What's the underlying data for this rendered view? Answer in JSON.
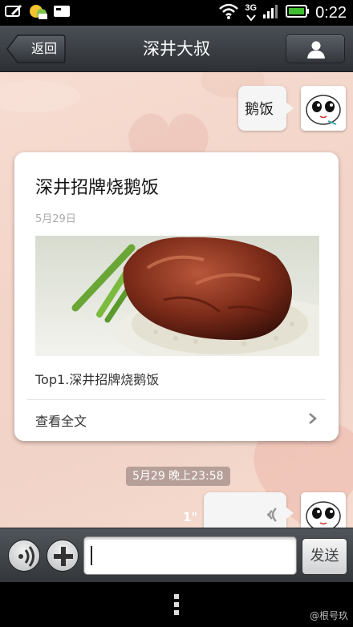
{
  "status_bar": {
    "time": "0:22",
    "network": "3G",
    "icons": [
      "edit-note-icon",
      "chat-app-icon",
      "message-icon",
      "wifi-icon",
      "sync-icon",
      "signal-icon",
      "battery-icon"
    ]
  },
  "header": {
    "back_label": "返回",
    "title": "深井大叔",
    "profile_icon": "person-icon"
  },
  "messages": {
    "outgoing_text": "鹅饭",
    "article": {
      "title": "深井招牌烧鹅饭",
      "date": "5月29日",
      "description": "Top1.深井招牌烧鹅饭",
      "read_all": "查看全文"
    },
    "timestamp": "5月29 晚上23:58",
    "voice_duration": "1\""
  },
  "input_bar": {
    "voice_icon": "voice-mode-icon",
    "plus_icon": "plus-icon",
    "input_value": "",
    "send_label": "发送"
  },
  "nav": {
    "menu_icon": "menu-dots-icon",
    "watermark": "@根号玖"
  },
  "colors": {
    "chat_background": "#f3d4c8",
    "header_background": "#3a3e43",
    "timestamp_bg": "#a08c87"
  }
}
